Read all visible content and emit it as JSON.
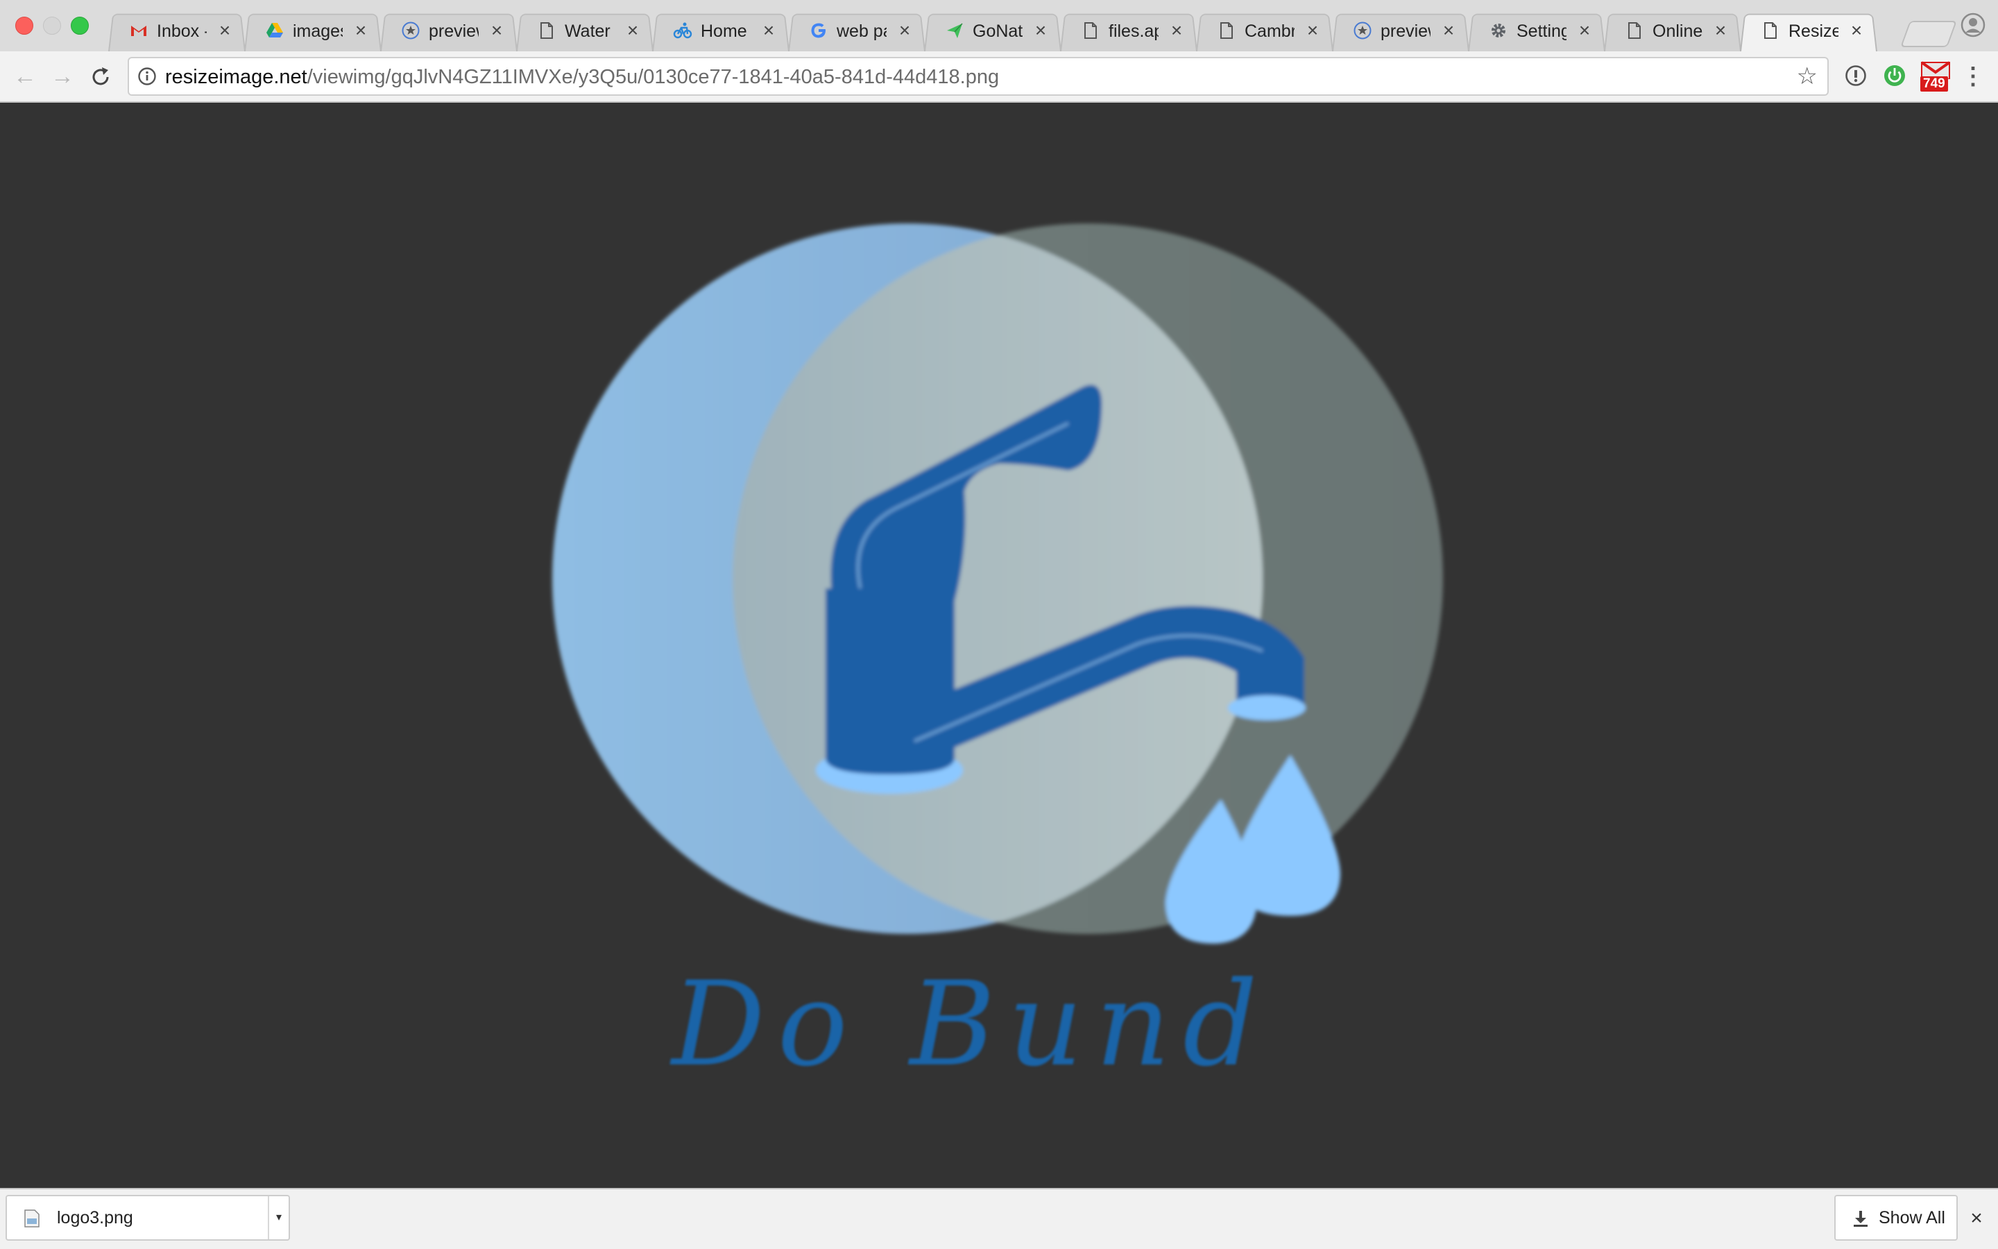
{
  "browser": {
    "tabs": [
      {
        "title": "Inbox - ",
        "icon": "gmail-icon",
        "color": "#d93025",
        "active": false
      },
      {
        "title": "images",
        "icon": "google-drive-icon",
        "color": "#1fa463",
        "active": false
      },
      {
        "title": "preview",
        "icon": "star-badge-icon",
        "color": "#4a7bd1",
        "active": false
      },
      {
        "title": "Water D",
        "icon": "document-icon",
        "color": "#555555",
        "active": false
      },
      {
        "title": "Home",
        "icon": "bicycle-icon",
        "color": "#2a86d8",
        "active": false
      },
      {
        "title": "web pag",
        "icon": "google-icon",
        "color": "#4285f4",
        "active": false
      },
      {
        "title": "GoNativ",
        "icon": "paper-plane-icon",
        "color": "#3fbf5a",
        "active": false
      },
      {
        "title": "files.app",
        "icon": "document-icon",
        "color": "#555555",
        "active": false
      },
      {
        "title": "Cambric",
        "icon": "document-icon",
        "color": "#555555",
        "active": false
      },
      {
        "title": "preview",
        "icon": "star-badge-icon",
        "color": "#4a7bd1",
        "active": false
      },
      {
        "title": "Settings",
        "icon": "gear-icon",
        "color": "#5f6368",
        "active": false
      },
      {
        "title": "Online I",
        "icon": "document-icon",
        "color": "#555555",
        "active": false
      },
      {
        "title": "ResizeIn",
        "icon": "document-icon",
        "color": "#555555",
        "active": true
      }
    ],
    "address": {
      "host": "resizeimage.net",
      "path": "/viewimg/gqJlvN4GZ11IMVXe/y3Q5u/0130ce77-1841-40a5-841d-44d418.png"
    },
    "extension_badge": "749"
  },
  "content": {
    "logo_text": "Do Bund",
    "colors": {
      "background": "#333333",
      "circle_left": "#8ab5dd",
      "circle_right": "#6d7a78",
      "overlap": "#a9bcbf",
      "faucet": "#1a5fa6",
      "drops": "#8cc8ff"
    }
  },
  "downloads": {
    "file_name": "logo3.png",
    "show_all_label": "Show All"
  }
}
